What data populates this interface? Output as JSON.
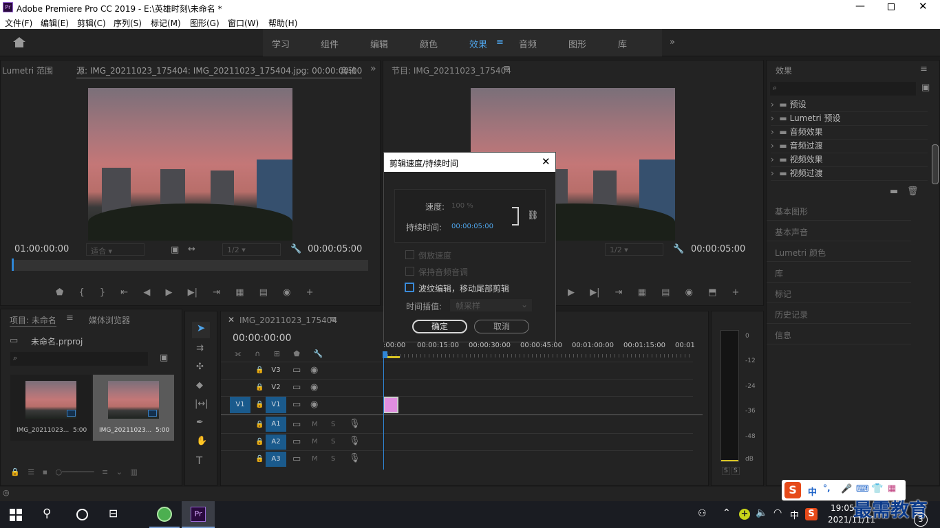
{
  "window": {
    "title": "Adobe Premiere Pro CC 2019 - E:\\英雄时刻\\未命名 *",
    "app_icon": "Pr"
  },
  "menu": [
    "文件(F)",
    "编辑(E)",
    "剪辑(C)",
    "序列(S)",
    "标记(M)",
    "图形(G)",
    "窗口(W)",
    "帮助(H)"
  ],
  "workspaces": [
    "学习",
    "组件",
    "编辑",
    "颜色",
    "效果",
    "音频",
    "图形",
    "库"
  ],
  "active_workspace": "效果",
  "source": {
    "tab_lumetri": "Lumetri 范围",
    "tab_source": "源: IMG_20211023_175404: IMG_20211023_175404.jpg: 00:00:00:00",
    "tab_audio": "音轨",
    "tc_left": "01:00:00:00",
    "tc_right": "00:00:05:00",
    "fit": "适合",
    "res": "1/2"
  },
  "program": {
    "tab": "节目: IMG_20211023_175404",
    "tc_right": "00:00:05:00",
    "res": "1/2"
  },
  "effects": {
    "tab": "效果",
    "items": [
      "预设",
      "Lumetri 预设",
      "音频效果",
      "音频过渡",
      "视频效果",
      "视频过渡"
    ],
    "panels": [
      "基本图形",
      "基本声音",
      "Lumetri 颜色",
      "库",
      "标记",
      "历史记录",
      "信息"
    ]
  },
  "project": {
    "tab": "项目: 未命名",
    "tab2": "媒体浏览器",
    "file": "未命名.prproj",
    "clips": [
      {
        "name": "IMG_20211023...",
        "dur": "5:00"
      },
      {
        "name": "IMG_20211023...",
        "dur": "5:00"
      }
    ]
  },
  "timeline": {
    "tab": "IMG_20211023_175404",
    "tc": "00:00:00:00",
    "ruler": [
      ":00:00",
      "00:00:15:00",
      "00:00:30:00",
      "00:00:45:00",
      "00:01:00:00",
      "00:01:15:00",
      "00:01"
    ],
    "video_tracks": [
      "V3",
      "V2",
      "V1"
    ],
    "audio_tracks": [
      "A1",
      "A2",
      "A3"
    ],
    "src_v1": "V1",
    "m": "M",
    "s": "S"
  },
  "meter": {
    "ticks": [
      "0",
      "-12",
      "-24",
      "-36",
      "-48",
      "dB"
    ],
    "s": "S"
  },
  "dialog": {
    "title": "剪辑速度/持续时间",
    "speed_label": "速度:",
    "speed_value": "100 %",
    "duration_label": "持续时间:",
    "duration_value": "00:00:05:00",
    "reverse": "倒放速度",
    "maintain_pitch": "保持音频音调",
    "ripple": "波纹编辑，移动尾部剪辑",
    "interp_label": "时间插值:",
    "interp_value": "帧采样",
    "ok": "确定",
    "cancel": "取消"
  },
  "ime": {
    "label": "中",
    "punct": "°,"
  },
  "taskbar": {
    "time": "19:05",
    "date": "2021/11/11",
    "lang": "中",
    "badge": "3",
    "watermark": "最需教育"
  }
}
